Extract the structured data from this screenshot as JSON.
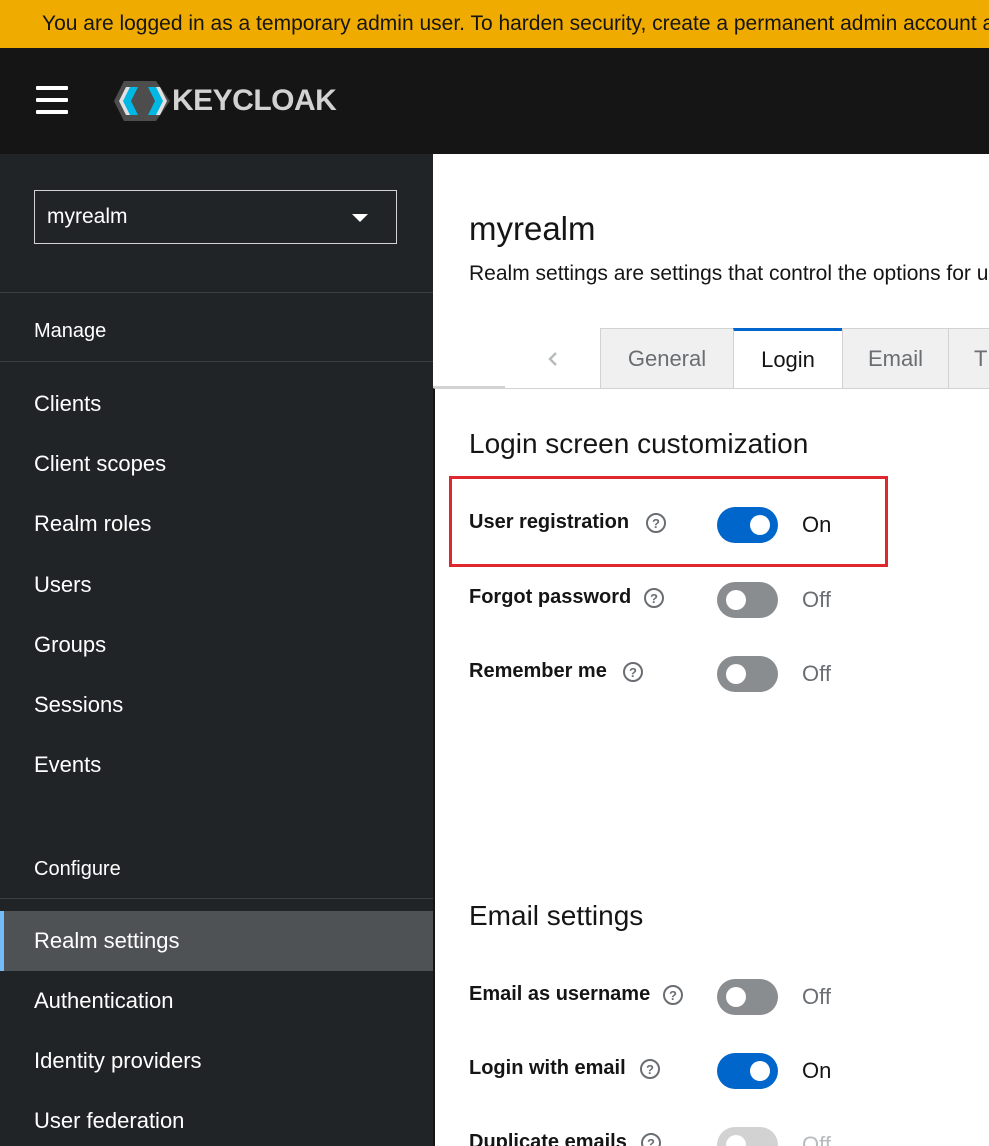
{
  "banner": {
    "text": "You are logged in as a temporary admin user. To harden security, create a permanent admin account and delete the temporary one."
  },
  "masthead": {
    "logo_text": "KEYCLOAK"
  },
  "sidebar": {
    "realm": "myrealm",
    "manage_title": "Manage",
    "manage_items": [
      {
        "label": "Clients"
      },
      {
        "label": "Client scopes"
      },
      {
        "label": "Realm roles"
      },
      {
        "label": "Users"
      },
      {
        "label": "Groups"
      },
      {
        "label": "Sessions"
      },
      {
        "label": "Events"
      }
    ],
    "configure_title": "Configure",
    "configure_items": [
      {
        "label": "Realm settings",
        "active": true
      },
      {
        "label": "Authentication"
      },
      {
        "label": "Identity providers"
      },
      {
        "label": "User federation"
      }
    ]
  },
  "main": {
    "title": "myrealm",
    "description": "Realm settings are settings that control the options for users, applications, roles, and groups in the current realm.",
    "tabs": [
      {
        "label": "General"
      },
      {
        "label": "Login",
        "active": true
      },
      {
        "label": "Email"
      },
      {
        "label": "Themes"
      }
    ],
    "login_section": {
      "heading": "Login screen customization",
      "fields": [
        {
          "label": "User registration",
          "state": "On"
        },
        {
          "label": "Forgot password",
          "state": "Off"
        },
        {
          "label": "Remember me",
          "state": "Off"
        }
      ]
    },
    "email_section": {
      "heading": "Email settings",
      "fields": [
        {
          "label": "Email as username",
          "state": "Off"
        },
        {
          "label": "Login with email",
          "state": "On"
        },
        {
          "label": "Duplicate emails",
          "state": "Off"
        }
      ]
    },
    "help_glyph": "?"
  }
}
